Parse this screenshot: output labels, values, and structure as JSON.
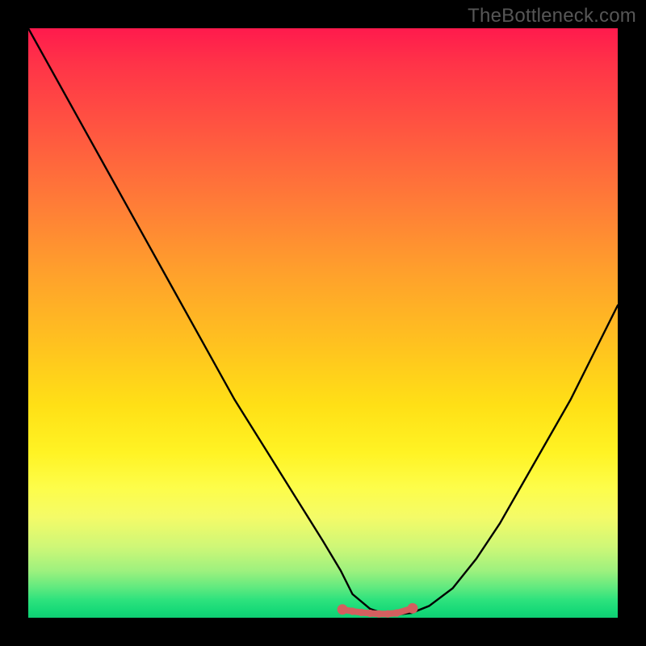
{
  "watermark": "TheBottleneck.com",
  "colors": {
    "background": "#000000",
    "gradient_top": "#ff1a4d",
    "gradient_bottom": "#0fce73",
    "curve": "#000000",
    "marker": "#d45f5f"
  },
  "chart_data": {
    "type": "line",
    "title": "",
    "xlabel": "",
    "ylabel": "",
    "xlim": [
      0,
      100
    ],
    "ylim": [
      0,
      100
    ],
    "description": "Bottleneck-style V-curve on a rainbow vertical gradient. The y-axis represents bottleneck percentage (top = 100% bottleneck / red, bottom = 0% / green). The curve descends steeply from the top-left, reaches a flat minimum plateau near x=55–65 at y≈0, then rises again toward the right, ending near y≈53 at x=100.",
    "series": [
      {
        "name": "bottleneck-curve",
        "x": [
          0,
          5,
          10,
          15,
          20,
          25,
          30,
          35,
          40,
          45,
          50,
          53,
          55,
          58,
          60,
          63,
          65,
          68,
          72,
          76,
          80,
          84,
          88,
          92,
          96,
          100
        ],
        "y": [
          100,
          91,
          82,
          73,
          64,
          55,
          46,
          37,
          29,
          21,
          13,
          8,
          4,
          1.5,
          0.8,
          0.6,
          0.8,
          2,
          5,
          10,
          16,
          23,
          30,
          37,
          45,
          53
        ]
      }
    ],
    "markers": {
      "name": "plateau-dots",
      "color": "#d45f5f",
      "points": [
        {
          "x": 53.3,
          "y": 1.4
        },
        {
          "x": 55.0,
          "y": 1.1
        },
        {
          "x": 56.5,
          "y": 0.9
        },
        {
          "x": 58.0,
          "y": 0.75
        },
        {
          "x": 59.5,
          "y": 0.65
        },
        {
          "x": 61.0,
          "y": 0.65
        },
        {
          "x": 62.5,
          "y": 0.8
        },
        {
          "x": 65.2,
          "y": 1.6
        }
      ]
    }
  }
}
